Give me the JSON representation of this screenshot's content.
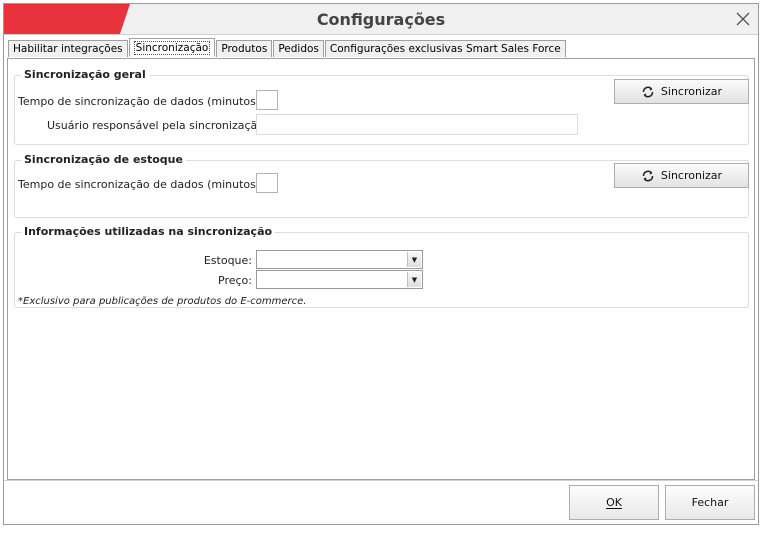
{
  "window": {
    "title": "Configurações",
    "accent_color": "#e8323c",
    "close_icon": "close-icon"
  },
  "tabs": [
    {
      "label": "Habilitar integrações",
      "active": false
    },
    {
      "label": "Sincronização",
      "active": true
    },
    {
      "label": "Produtos",
      "active": false
    },
    {
      "label": "Pedidos",
      "active": false
    },
    {
      "label": "Configurações exclusivas Smart Sales Force",
      "active": false
    }
  ],
  "sync_general": {
    "title": "Sincronização geral",
    "interval_label": "Tempo de sincronização de dados (minutos):",
    "interval_value": "",
    "user_label": "Usuário responsável pela sincronização:",
    "user_value": "",
    "button_label": "Sincronizar",
    "button_icon": "refresh-icon"
  },
  "sync_stock": {
    "title": "Sincronização de estoque",
    "interval_label": "Tempo de sincronização de dados (minutos):",
    "interval_value": "",
    "button_label": "Sincronizar",
    "button_icon": "refresh-icon"
  },
  "sync_info": {
    "title": "Informações utilizadas na sincronização",
    "stock_label": "Estoque:",
    "stock_value": "",
    "price_label": "Preço:",
    "price_value": "",
    "note": "*Exclusivo para publicações de produtos do E-commerce."
  },
  "footer": {
    "ok_label": "OK",
    "close_label": "Fechar"
  }
}
